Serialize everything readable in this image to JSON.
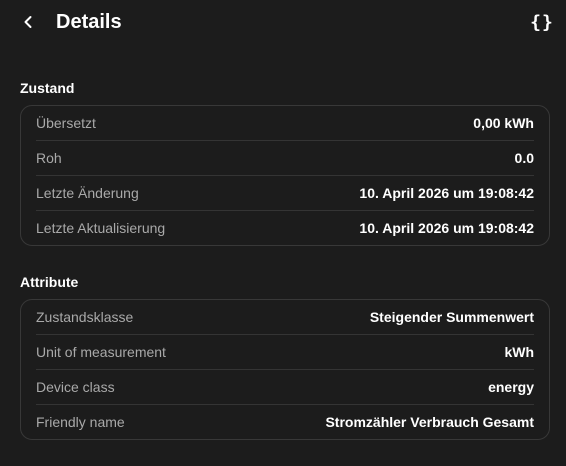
{
  "header": {
    "title": "Details",
    "json_label": "{}"
  },
  "state": {
    "title": "Zustand",
    "rows": [
      {
        "label": "Übersetzt",
        "value": "0,00 kWh"
      },
      {
        "label": "Roh",
        "value": "0.0"
      },
      {
        "label": "Letzte Änderung",
        "value": "10. April 2026 um 19:08:42"
      },
      {
        "label": "Letzte Aktualisierung",
        "value": "10. April 2026 um 19:08:42"
      }
    ]
  },
  "attributes": {
    "title": "Attribute",
    "rows": [
      {
        "label": "Zustandsklasse",
        "value": "Steigender Summenwert"
      },
      {
        "label": "Unit of measurement",
        "value": "kWh"
      },
      {
        "label": "Device class",
        "value": "energy"
      },
      {
        "label": "Friendly name",
        "value": "Stromzähler Verbrauch Gesamt"
      }
    ]
  }
}
